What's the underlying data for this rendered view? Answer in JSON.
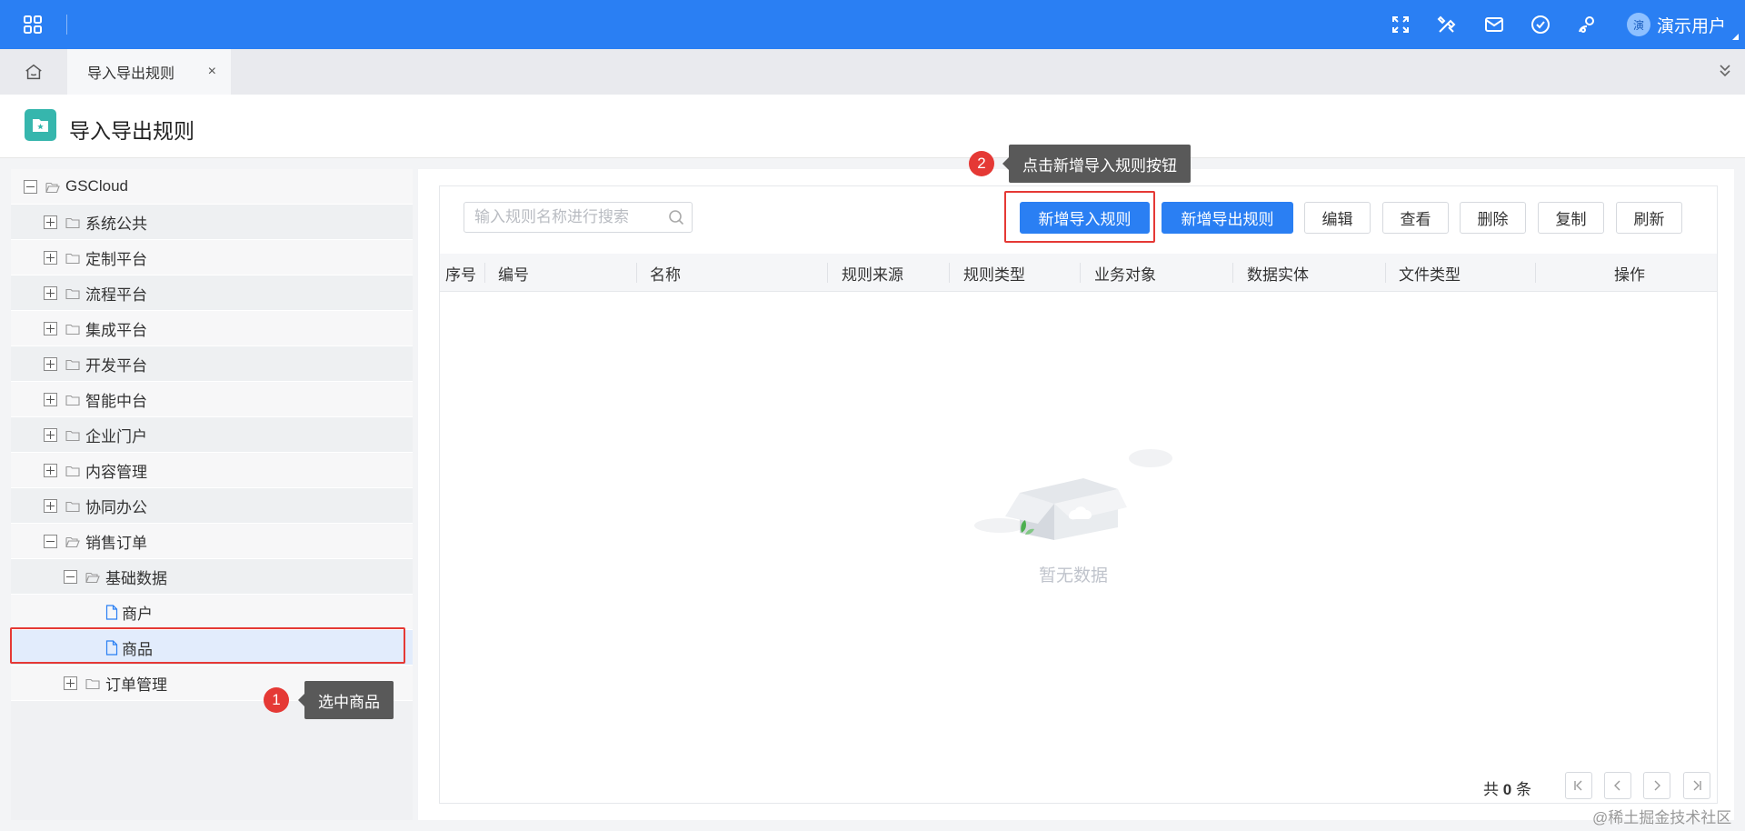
{
  "header": {
    "icons": [
      "apps-grid-icon",
      "fullscreen-icon",
      "tools-icon",
      "mail-icon",
      "check-circle-icon",
      "user-settings-icon"
    ],
    "user": {
      "avatar_text": "演",
      "name": "演示用户"
    }
  },
  "tabs": {
    "home_icon": "home-icon",
    "active": {
      "label": "导入导出规则",
      "close": "×"
    },
    "more_icon": "chevron-double-down-icon"
  },
  "page": {
    "title": "导入导出规则",
    "icon": "folder-star-icon"
  },
  "tree": {
    "items": [
      {
        "label": "GSCloud",
        "level": 0,
        "toggle": "minus",
        "icon": "folder-open-icon"
      },
      {
        "label": "系统公共",
        "level": 1,
        "toggle": "plus",
        "icon": "folder-icon"
      },
      {
        "label": "定制平台",
        "level": 1,
        "toggle": "plus",
        "icon": "folder-icon"
      },
      {
        "label": "流程平台",
        "level": 1,
        "toggle": "plus",
        "icon": "folder-icon"
      },
      {
        "label": "集成平台",
        "level": 1,
        "toggle": "plus",
        "icon": "folder-icon"
      },
      {
        "label": "开发平台",
        "level": 1,
        "toggle": "plus",
        "icon": "folder-icon"
      },
      {
        "label": "智能中台",
        "level": 1,
        "toggle": "plus",
        "icon": "folder-icon"
      },
      {
        "label": "企业门户",
        "level": 1,
        "toggle": "plus",
        "icon": "folder-icon"
      },
      {
        "label": "内容管理",
        "level": 1,
        "toggle": "plus",
        "icon": "folder-icon"
      },
      {
        "label": "协同办公",
        "level": 1,
        "toggle": "plus",
        "icon": "folder-icon"
      },
      {
        "label": "销售订单",
        "level": 1,
        "toggle": "minus",
        "icon": "folder-open-icon"
      },
      {
        "label": "基础数据",
        "level": 2,
        "toggle": "minus",
        "icon": "folder-open-icon"
      },
      {
        "label": "商户",
        "level": 3,
        "toggle": "none",
        "icon": "document-icon"
      },
      {
        "label": "商品",
        "level": 3,
        "toggle": "none",
        "icon": "document-icon",
        "selected": true
      },
      {
        "label": "订单管理",
        "level": 2,
        "toggle": "plus",
        "icon": "folder-icon"
      }
    ]
  },
  "toolbar": {
    "search_placeholder": "输入规则名称进行搜索",
    "buttons": {
      "add_import": "新增导入规则",
      "add_export": "新增导出规则",
      "edit": "编辑",
      "view": "查看",
      "delete": "删除",
      "copy": "复制",
      "refresh": "刷新"
    }
  },
  "table": {
    "columns": [
      "序号",
      "编号",
      "名称",
      "规则来源",
      "规则类型",
      "业务对象",
      "数据实体",
      "文件类型",
      "操作"
    ],
    "rows": [],
    "empty_text": "暂无数据"
  },
  "pager": {
    "prefix": "共",
    "total": "0",
    "suffix": "条"
  },
  "annotations": {
    "step1": {
      "num": "1",
      "text": "选中商品"
    },
    "step2": {
      "num": "2",
      "text": "点击新增导入规则按钮"
    }
  },
  "watermark": "@稀土掘金技术社区",
  "colors": {
    "brand": "#2a7ff3",
    "highlight": "#e53935",
    "selected_row": "#e2ecfc",
    "title_icon": "#36b6ad"
  }
}
